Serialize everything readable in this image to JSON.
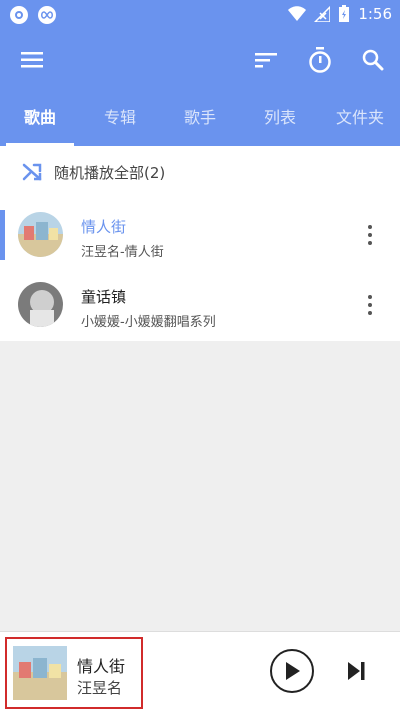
{
  "status_bar": {
    "time": "1:56"
  },
  "app_bar": {
    "menu_icon": "menu-icon",
    "sort_icon": "sort-icon",
    "timer_icon": "timer-icon",
    "search_icon": "search-icon"
  },
  "tabs": [
    {
      "label": "歌曲"
    },
    {
      "label": "专辑"
    },
    {
      "label": "歌手"
    },
    {
      "label": "列表"
    },
    {
      "label": "文件夹"
    }
  ],
  "shuffle": {
    "label": "随机播放全部(2)"
  },
  "songs": [
    {
      "title": "情人街",
      "subtitle": "汪昱名-情人街"
    },
    {
      "title": "童话镇",
      "subtitle": "小媛媛-小媛媛翻唱系列"
    }
  ],
  "player": {
    "title": "情人街",
    "artist": "汪昱名"
  },
  "colors": {
    "accent": "#6a93ee",
    "highlight_border": "#d12b2b"
  }
}
